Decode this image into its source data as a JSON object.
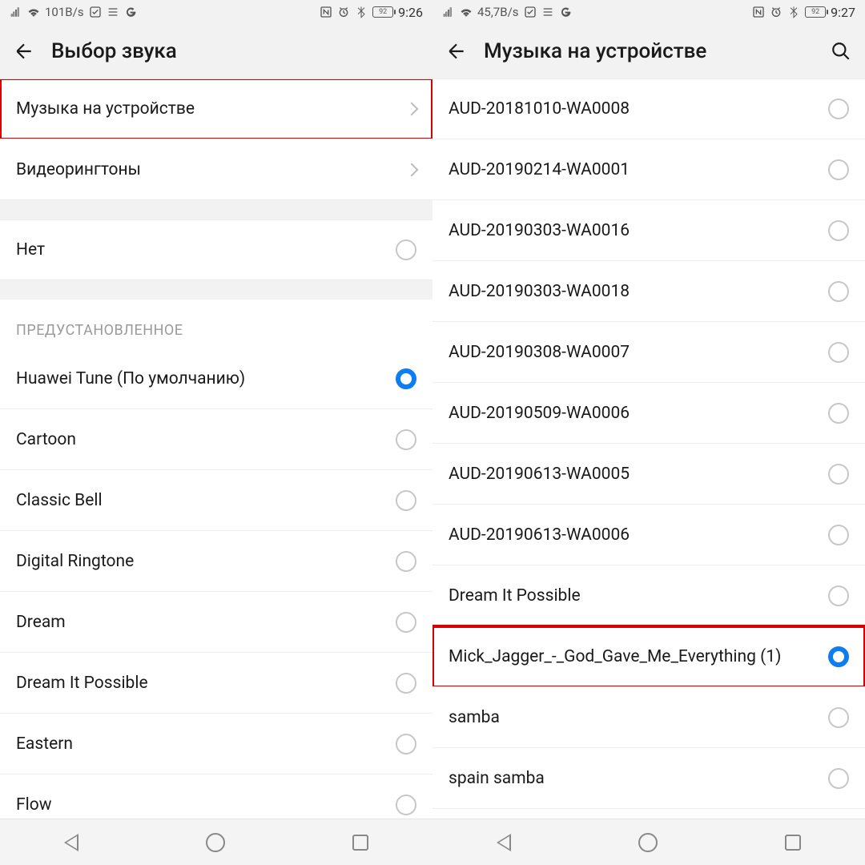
{
  "left": {
    "status": {
      "net": "101B/s",
      "battery": "92",
      "clock": "9:26"
    },
    "title": "Выбор звука",
    "nav_rows": [
      {
        "label": "Музыка на устройстве",
        "highlight": true
      },
      {
        "label": "Видеорингтоны",
        "highlight": false
      }
    ],
    "none_label": "Нет",
    "section_label": "ПРЕДУСТАНОВЛЕННОЕ",
    "ringtones": [
      {
        "label": "Huawei Tune (По умолчанию)",
        "selected": true
      },
      {
        "label": "Cartoon",
        "selected": false
      },
      {
        "label": "Classic Bell",
        "selected": false
      },
      {
        "label": "Digital Ringtone",
        "selected": false
      },
      {
        "label": "Dream",
        "selected": false
      },
      {
        "label": "Dream It Possible",
        "selected": false
      },
      {
        "label": "Eastern",
        "selected": false
      },
      {
        "label": "Flow",
        "selected": false
      }
    ]
  },
  "right": {
    "status": {
      "net": "45,7B/s",
      "battery": "92",
      "clock": "9:27"
    },
    "title": "Музыка на устройстве",
    "tracks": [
      {
        "label": "AUD-20181010-WA0008",
        "selected": false,
        "highlight": false
      },
      {
        "label": "AUD-20190214-WA0001",
        "selected": false,
        "highlight": false
      },
      {
        "label": "AUD-20190303-WA0016",
        "selected": false,
        "highlight": false
      },
      {
        "label": "AUD-20190303-WA0018",
        "selected": false,
        "highlight": false
      },
      {
        "label": "AUD-20190308-WA0007",
        "selected": false,
        "highlight": false
      },
      {
        "label": "AUD-20190509-WA0006",
        "selected": false,
        "highlight": false
      },
      {
        "label": "AUD-20190613-WA0005",
        "selected": false,
        "highlight": false
      },
      {
        "label": "AUD-20190613-WA0006",
        "selected": false,
        "highlight": false
      },
      {
        "label": "Dream It Possible",
        "selected": false,
        "highlight": false
      },
      {
        "label": "Mick_Jagger_-_God_Gave_Me_Everything (1)",
        "selected": true,
        "highlight": true
      },
      {
        "label": "samba",
        "selected": false,
        "highlight": false
      },
      {
        "label": "spain samba",
        "selected": false,
        "highlight": false
      }
    ]
  }
}
